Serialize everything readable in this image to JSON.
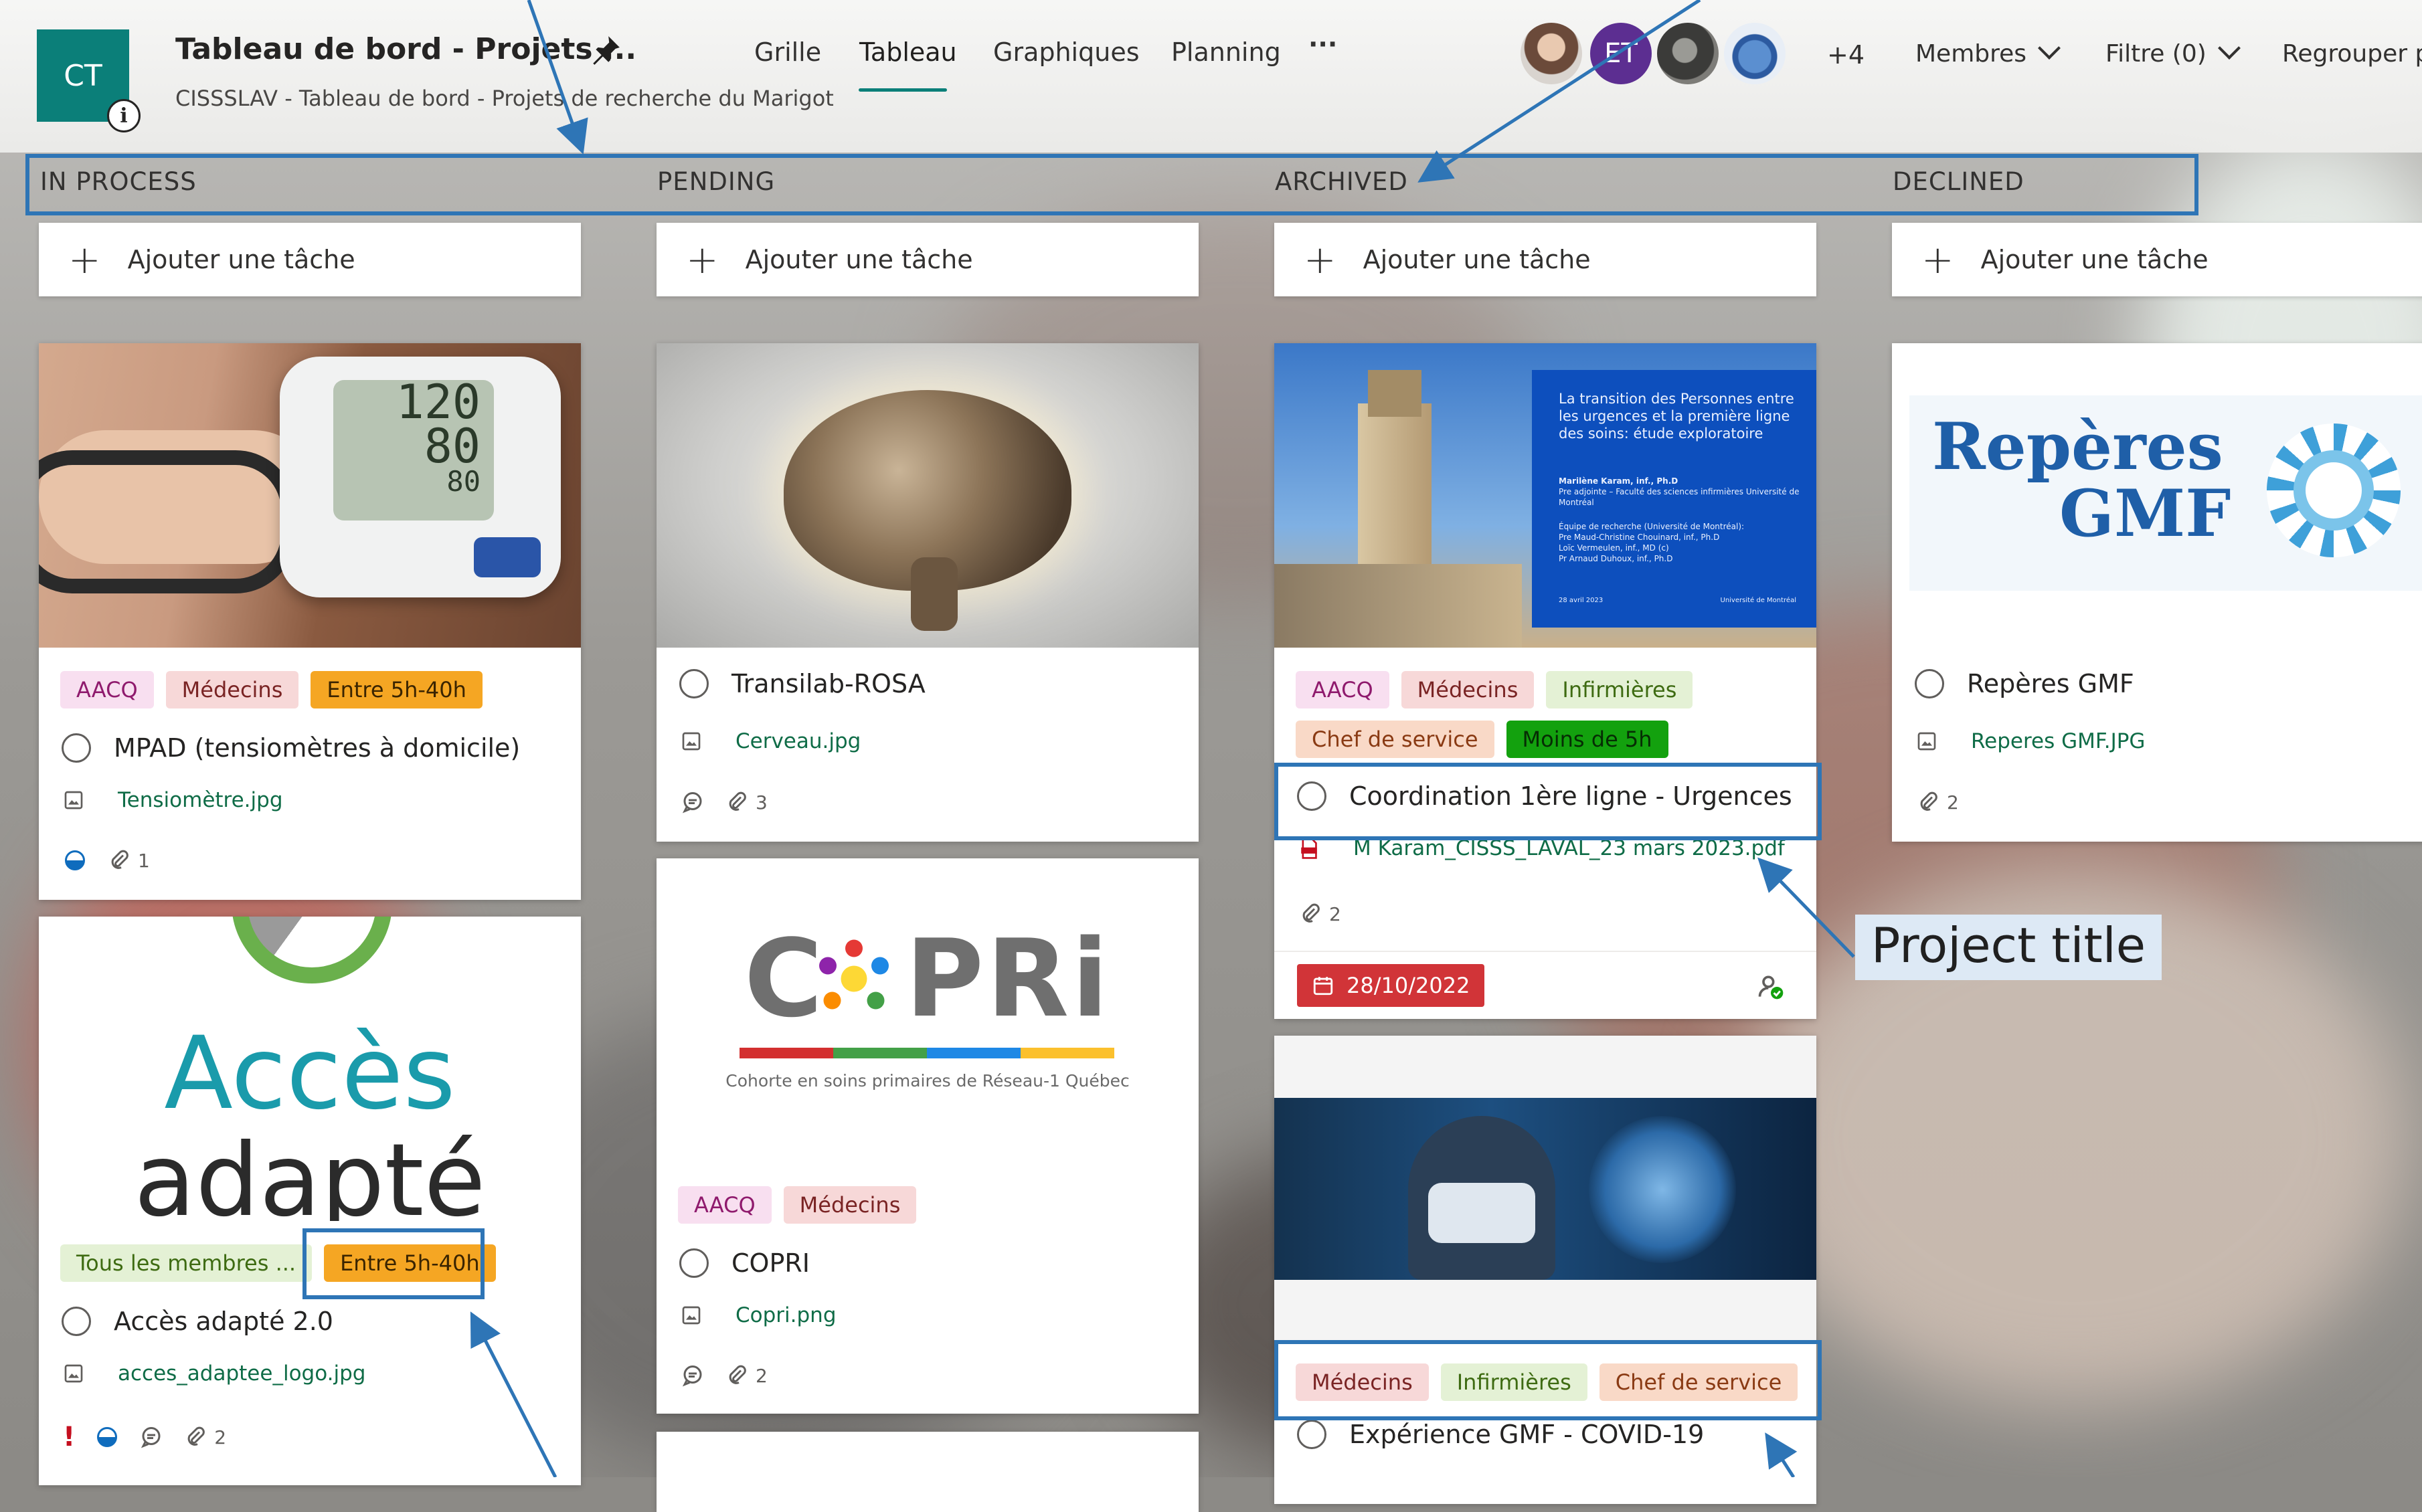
{
  "header": {
    "logo_initials": "CT",
    "title": "Tableau de bord - Projets ...",
    "subtitle": "CISSSLAV - Tableau de bord - Projets de recherche du Marigot",
    "nav": [
      "Grille",
      "Tableau",
      "Graphiques",
      "Planning",
      "···"
    ],
    "active_nav": "Tableau",
    "avatar_initials": "ET",
    "more_members": "+4",
    "members_label": "Membres",
    "filter_label": "Filtre (0)",
    "group_label": "Regrouper pa"
  },
  "columns": [
    {
      "name": "IN PROCESS"
    },
    {
      "name": "PENDING"
    },
    {
      "name": "ARCHIVED"
    },
    {
      "name": "DECLINED"
    }
  ],
  "add_task_label": "Ajouter une tâche",
  "cards": {
    "mpad": {
      "tags": [
        "AACQ",
        "Médecins",
        "Entre 5h-40h"
      ],
      "title": "MPAD (tensiomètres à domicile)",
      "attachment": "Tensiomètre.jpg",
      "attach_count": "1",
      "screen": [
        "120",
        "80",
        "80"
      ]
    },
    "acces": {
      "tags": [
        "Tous les membres ...",
        "Entre 5h-40h"
      ],
      "title": "Accès adapté 2.0",
      "attachment": "acces_adaptee_logo.jpg",
      "attach_count": "2",
      "priority_mark": "!",
      "logo_line1": "Accès",
      "logo_line2": "adapté"
    },
    "transilab": {
      "title": "Transilab-ROSA",
      "attachment": "Cerveau.jpg",
      "attach_count": "3"
    },
    "copri": {
      "tags": [
        "AACQ",
        "Médecins"
      ],
      "title": "COPRI",
      "attachment": "Copri.png",
      "attach_count": "2",
      "logo_text": "C  PRi",
      "logo_caption": "Cohorte en soins primaires de Réseau-1 Québec"
    },
    "coordination": {
      "tags_row1": [
        "AACQ",
        "Médecins",
        "Infirmières"
      ],
      "tags_row2": [
        "Chef de service",
        "Moins de 5h"
      ],
      "title": "Coordination 1ère ligne - Urgences",
      "attachment": "M Karam_CISSS_LAVAL_23 mars 2023.pdf",
      "attach_count": "2",
      "due_date": "28/10/2022",
      "slide_title": "La transition des Personnes entre les urgences et la première ligne des soins: étude exploratoire",
      "slide_author": "Marilène Karam, inf., Ph.D",
      "slide_role": "Pre adjointe – Faculté des sciences infirmières Université de Montréal",
      "slide_team_title": "Équipe de recherche (Université de Montréal):",
      "slide_team": [
        "Pre Maud-Christine Chouinard, inf., Ph.D",
        "Loïc Vermeulen, inf., MD (c)",
        "Pr Arnaud Duhoux, inf., Ph.D"
      ],
      "slide_date": "28 avril 2023",
      "slide_logo": "Université de Montréal"
    },
    "covid": {
      "tags": [
        "Médecins",
        "Infirmières",
        "Chef de service"
      ],
      "title": "Expérience GMF - COVID-19"
    },
    "reperes": {
      "title": "Repères GMF",
      "attachment": "Reperes GMF.JPG",
      "attach_count": "2",
      "logo_line1": "Repères",
      "logo_line2": "GMF"
    }
  },
  "annotations": {
    "project_title": "Project title"
  },
  "colors": {
    "accent": "#0b7f79",
    "annotation": "#2e75b6",
    "due_date": "#d13438"
  }
}
